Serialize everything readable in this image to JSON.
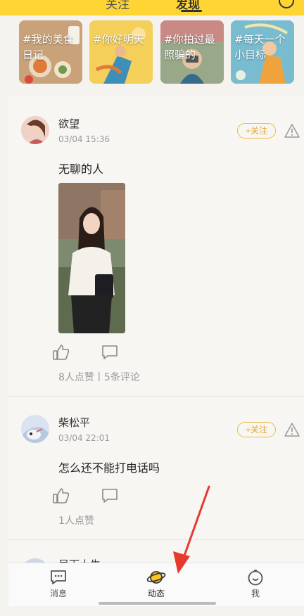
{
  "header": {
    "tab_left": "关注",
    "tab_right": "发现"
  },
  "topics": [
    {
      "label": "#我的美食日记",
      "bg": "#b9916a",
      "accent": "#e07a3a"
    },
    {
      "label": "#你好明天",
      "bg": "#f2c544",
      "accent": "#3d8fb8"
    },
    {
      "label": "#你拍过最照骗的",
      "bg": "#8a9a7a",
      "accent": "#d86a72"
    },
    {
      "label": "#每天一个小目标",
      "bg": "#6db2c9",
      "accent": "#f0a23c"
    }
  ],
  "posts": [
    {
      "username": "欲望",
      "timestamp": "03/04 15:36",
      "follow_label": "+关注",
      "text": "无聊的人",
      "stats": "8人点赞丨5条评论"
    },
    {
      "username": "柴松平",
      "timestamp": "03/04 22:01",
      "follow_label": "+关注",
      "text": "怎么还不能打电话吗",
      "stats": "1人点赞"
    },
    {
      "username": "早下大生"
    }
  ],
  "bottom_nav": [
    {
      "label": "消息",
      "icon": "message-icon"
    },
    {
      "label": "动态",
      "icon": "planet-icon"
    },
    {
      "label": "我",
      "icon": "profile-icon"
    }
  ],
  "colors": {
    "brand_yellow": "#ffd534",
    "follow_orange": "#e8a32a",
    "annotation_red": "#e63a2e"
  }
}
